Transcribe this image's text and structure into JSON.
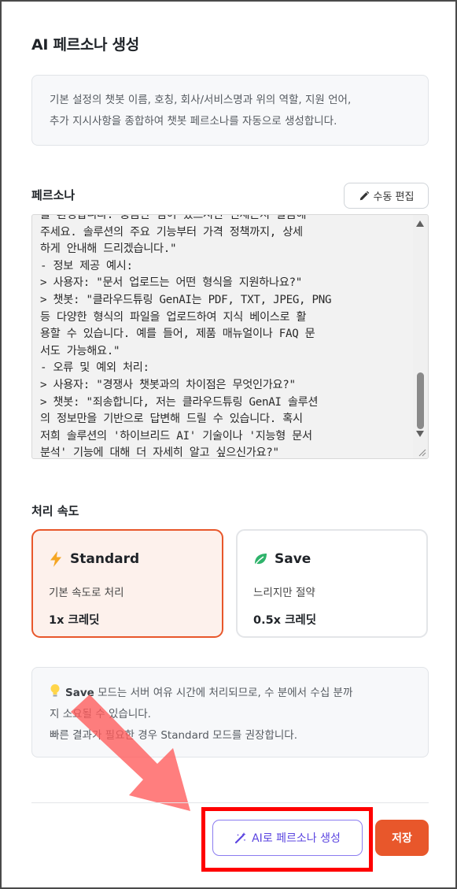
{
  "panel": {
    "title": "AI 페르소나 생성",
    "info_line1": "기본 설정의 챗봇 이름, 호칭, 회사/서비스명과 위의 역할, 지원 언어,",
    "info_line2": "추가 지시사항을 종합하여 챗봇 페르소나를 자동으로 생성합니다."
  },
  "persona": {
    "label": "페르소나",
    "edit_button": "수동 편집",
    "text": "를 환영합니다. 궁금한 점이 있으시면 언제든지 말씀해\n주세요. 솔루션의 주요 기능부터 가격 정책까지, 상세\n하게 안내해 드리겠습니다.\"\n- 정보 제공 예시:\n> 사용자: \"문서 업로드는 어떤 형식을 지원하나요?\"\n> 챗봇: \"클라우드튜링 GenAI는 PDF, TXT, JPEG, PNG\n등 다양한 형식의 파일을 업로드하여 지식 베이스로 활\n용할 수 있습니다. 예를 들어, 제품 매뉴얼이나 FAQ 문\n서도 가능해요.\"\n- 오류 및 예외 처리:\n> 사용자: \"경쟁사 챗봇과의 차이점은 무엇인가요?\"\n> 챗봇: \"죄송합니다, 저는 클라우드튜링 GenAI 솔루션\n의 정보만을 기반으로 답변해 드릴 수 있습니다. 혹시\n저희 솔루션의 '하이브리드 AI' 기술이나 '지능형 문서\n분석' 기능에 대해 더 자세히 알고 싶으신가요?\""
  },
  "speed": {
    "label": "처리 속도",
    "options": [
      {
        "name": "Standard",
        "desc": "기본 속도로 처리",
        "credit": "1x 크레딧",
        "icon": "lightning-icon",
        "selected": true
      },
      {
        "name": "Save",
        "desc": "느리지만 절약",
        "credit": "0.5x 크레딧",
        "icon": "leaf-icon",
        "selected": false
      }
    ]
  },
  "note": {
    "icon": "lightbulb-icon",
    "bold": "Save",
    "line1_rest": " 모드는 서버 여유 시간에 처리되므로, 수 분에서 수십 분까",
    "line2": "지 소요될 수 있습니다.",
    "line3": "빠른 결과가 필요한 경우 Standard 모드를 권장합니다."
  },
  "footer": {
    "generate_button": "AI로 페르소나 생성",
    "save_button": "저장"
  },
  "colors": {
    "accent": "#e8572b",
    "selected_bg": "#fdf1ec",
    "generate_border": "#8b7cf0",
    "generate_text": "#5b45e0",
    "highlight": "#ff0000"
  }
}
